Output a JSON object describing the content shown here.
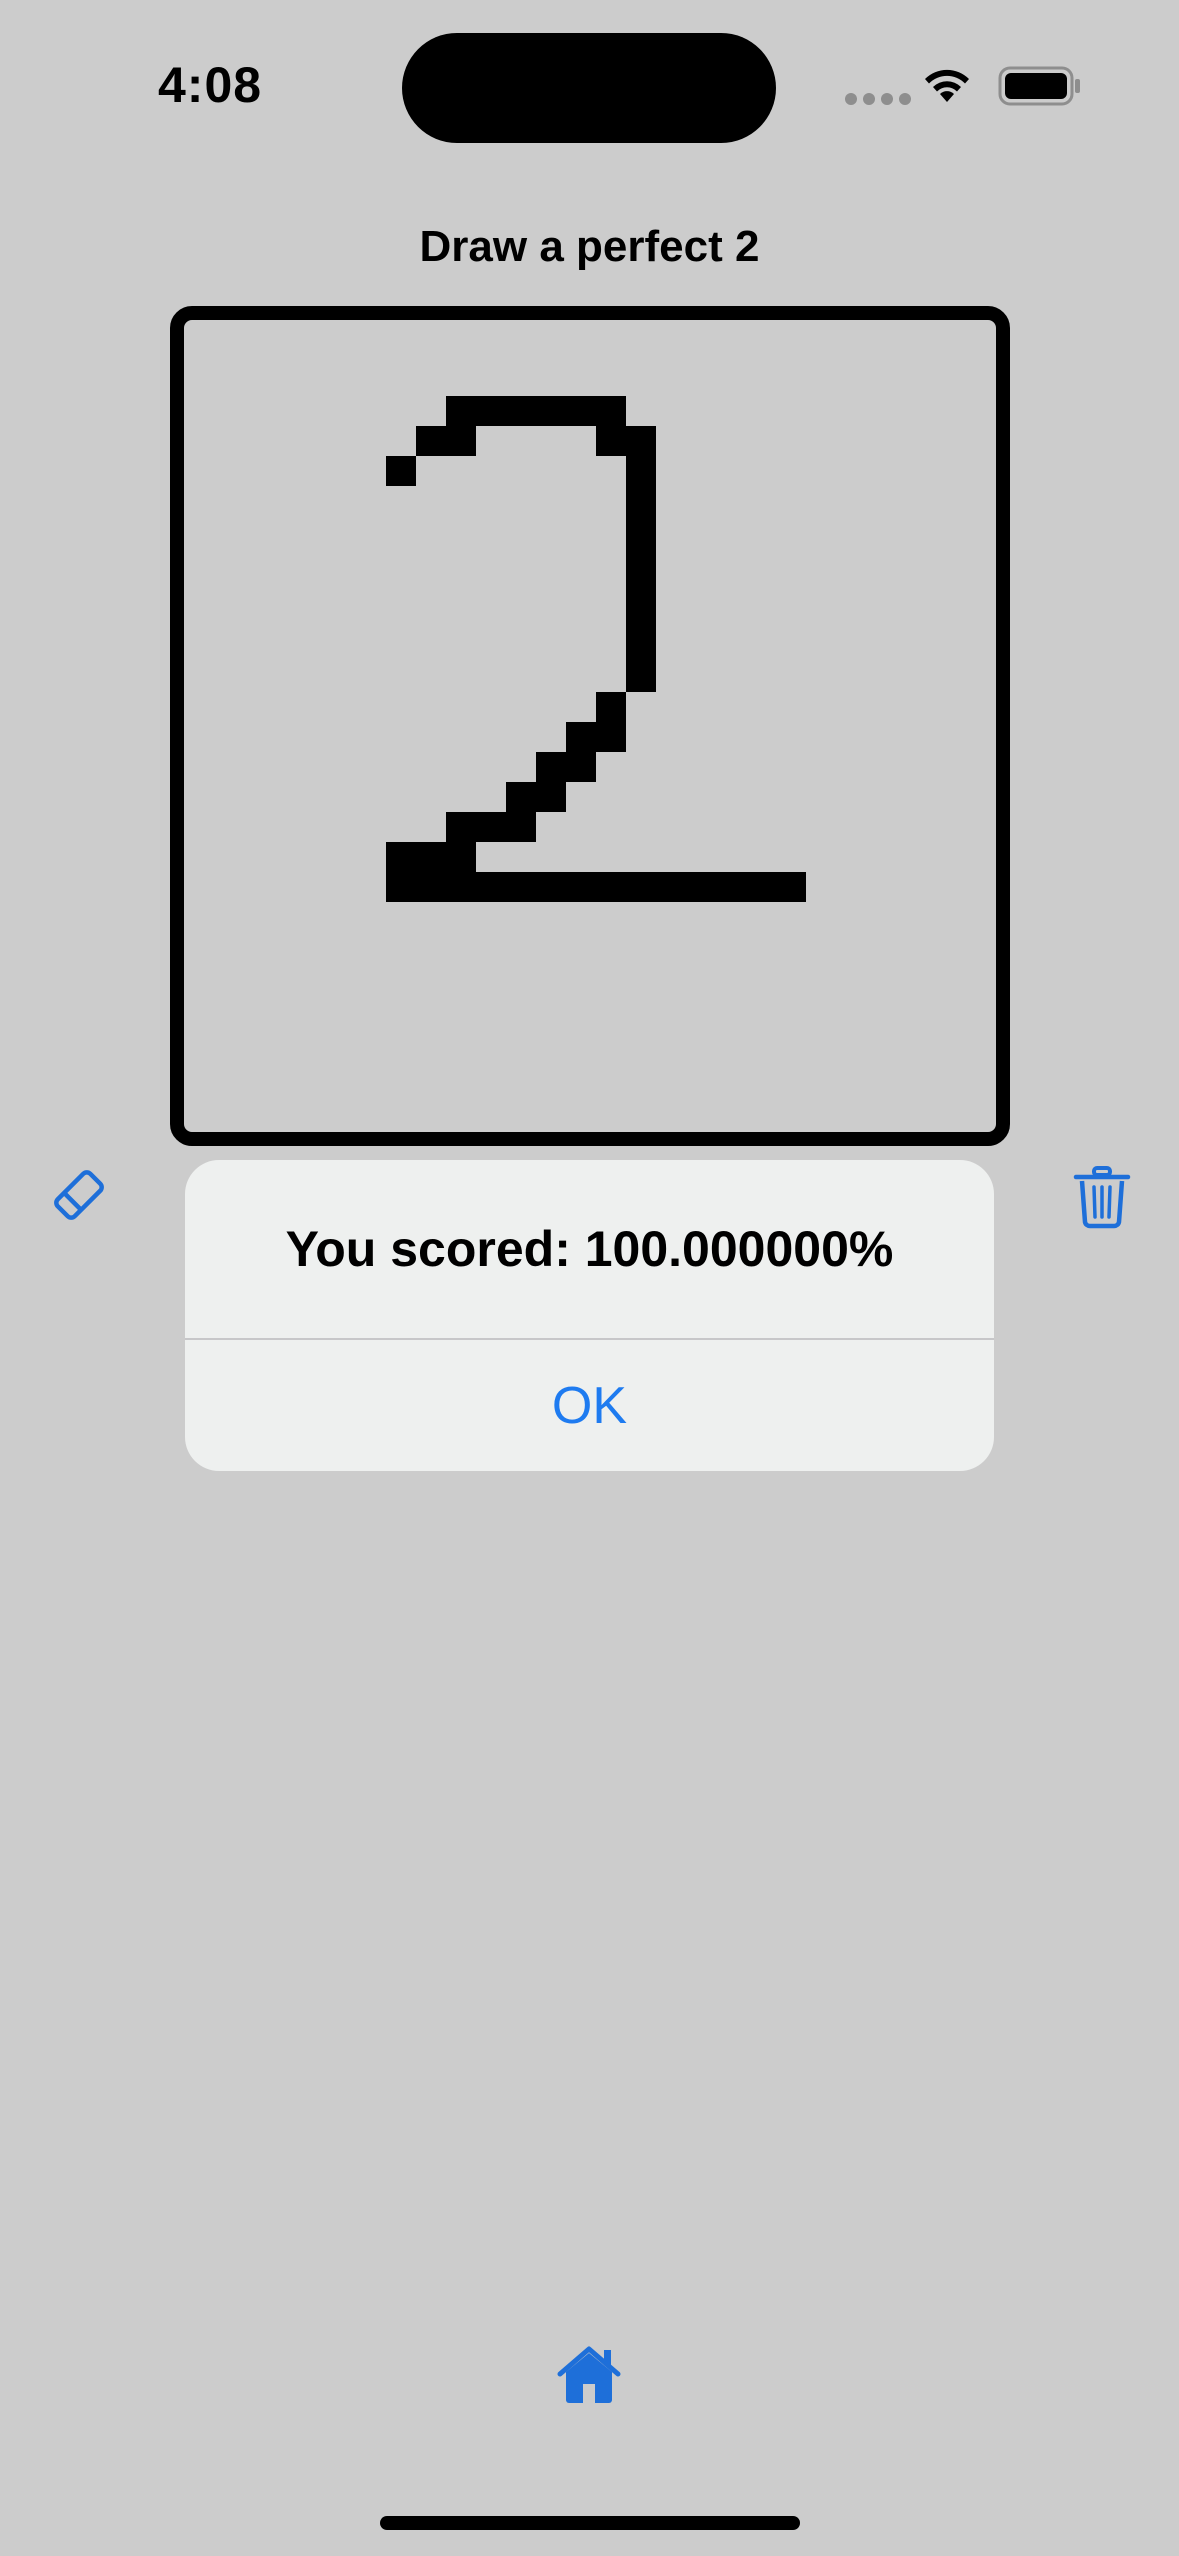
{
  "status_bar": {
    "time": "4:08"
  },
  "page": {
    "title": "Draw a perfect 2"
  },
  "toolbar": {
    "eraser_icon": "eraser-icon",
    "trash_icon": "trash-icon"
  },
  "alert": {
    "message": "You scored: 100.000000%",
    "ok_label": "OK"
  },
  "nav": {
    "home_icon": "house-icon"
  },
  "colors": {
    "accent": "#1e7bf0",
    "background": "#cccccc",
    "alert_bg": "#eef0ef"
  }
}
